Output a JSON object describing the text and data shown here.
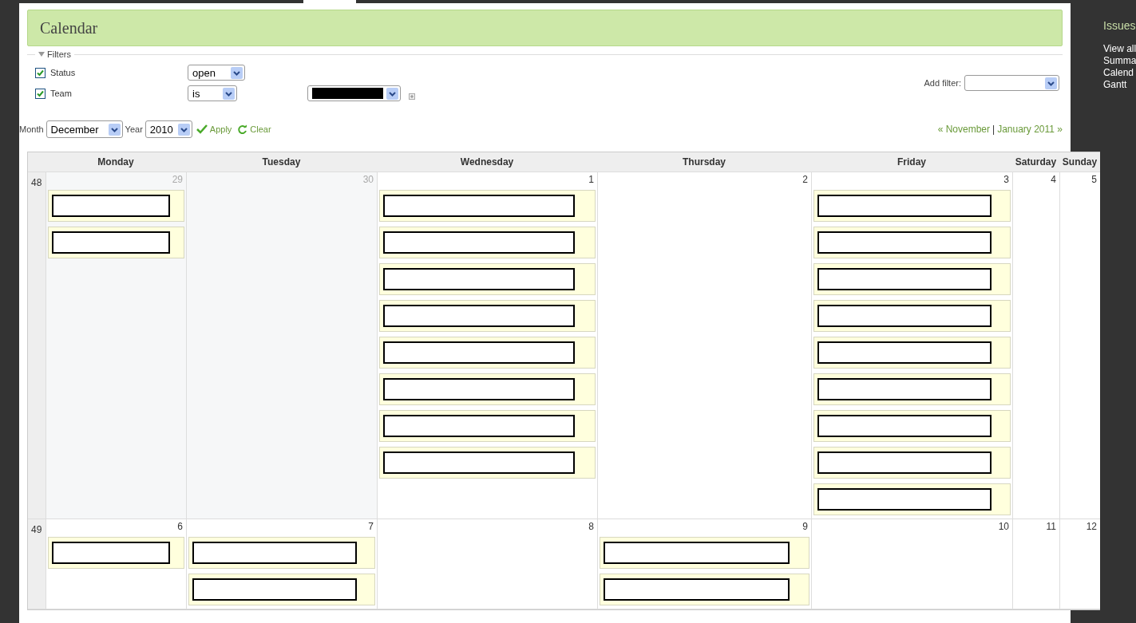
{
  "title": "Calendar",
  "filters": {
    "legend": "Filters",
    "expanded": true,
    "rows": [
      {
        "label": "Status",
        "checked": true,
        "operator": "open"
      },
      {
        "label": "Team",
        "checked": true,
        "operator": "is",
        "value_redacted": true
      }
    ],
    "add_filter_label": "Add filter:"
  },
  "period": {
    "month_label": "Month",
    "month": "December",
    "year_label": "Year",
    "year": "2010",
    "apply": "Apply",
    "clear": "Clear",
    "prev": "« November",
    "separator": "|",
    "next": "January 2011 »"
  },
  "calendar": {
    "days": [
      "Monday",
      "Tuesday",
      "Wednesday",
      "Thursday",
      "Friday",
      "Saturday",
      "Sunday"
    ],
    "weeks": [
      {
        "number": "48",
        "days": [
          {
            "date": "29",
            "other_month": true,
            "events": [
              {
                "kind": "redacted"
              },
              {
                "kind": "redacted"
              }
            ]
          },
          {
            "date": "30",
            "other_month": true
          },
          {
            "date": "1",
            "other_month": false,
            "events": [
              {
                "kind": "redacted"
              },
              {
                "kind": "redacted"
              },
              {
                "kind": "redacted"
              },
              {
                "kind": "redacted"
              },
              {
                "kind": "redacted"
              },
              {
                "kind": "redacted"
              },
              {
                "kind": "redacted"
              },
              {
                "kind": "redacted"
              }
            ]
          },
          {
            "date": "2",
            "other_month": false
          },
          {
            "date": "3",
            "other_month": false,
            "events": [
              {
                "kind": "redacted"
              },
              {
                "kind": "redacted"
              },
              {
                "kind": "redacted"
              },
              {
                "kind": "redacted"
              },
              {
                "kind": "redacted"
              },
              {
                "kind": "redacted"
              },
              {
                "kind": "redacted"
              },
              {
                "kind": "redacted"
              },
              {
                "kind": "redacted"
              }
            ]
          },
          {
            "date": "4",
            "other_month": false
          },
          {
            "date": "5",
            "other_month": false
          }
        ]
      },
      {
        "number": "49",
        "days": [
          {
            "date": "6",
            "other_month": false,
            "events": [
              {
                "kind": "redacted"
              }
            ]
          },
          {
            "date": "7",
            "other_month": false,
            "events": [
              {
                "kind": "redacted"
              },
              {
                "kind": "redacted"
              }
            ]
          },
          {
            "date": "8",
            "other_month": false
          },
          {
            "date": "9",
            "other_month": false,
            "events": [
              {
                "kind": "redacted"
              },
              {
                "kind": "redacted"
              }
            ]
          },
          {
            "date": "10",
            "other_month": false
          },
          {
            "date": "11",
            "other_month": false
          },
          {
            "date": "12",
            "other_month": false
          }
        ]
      }
    ]
  },
  "sidebar": {
    "title": "Issues",
    "links": [
      "View all",
      "Summa",
      "Calend",
      "Gantt"
    ]
  }
}
